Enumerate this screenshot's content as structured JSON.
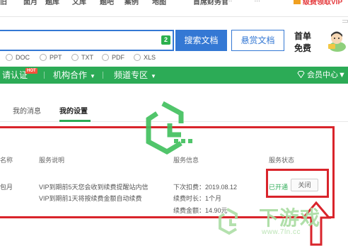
{
  "topbar": {
    "nav": [
      "旧",
      "面月",
      "题库",
      "文库",
      "题吧",
      "案例",
      "地图",
      "首席财务官"
    ],
    "user_id": "...********...",
    "vip_link": "级费领取VIP"
  },
  "search": {
    "count_badge": "2",
    "search_button": "搜索文档",
    "reward_button": "悬赏文档"
  },
  "promo": {
    "line1": "首单",
    "line2": "免费"
  },
  "file_types": [
    "DOC",
    "PPT",
    "TXT",
    "PDF",
    "XLS"
  ],
  "green_nav": {
    "items": [
      "请认证",
      "机构合作",
      "频道专区"
    ],
    "hot_tag": "HOT",
    "member_center": "会员中心"
  },
  "tabs": {
    "messages": "我的消息",
    "settings": "我的设置"
  },
  "service_table": {
    "headers": [
      "名称",
      "服务说明",
      "服务信息",
      "服务状态"
    ],
    "row": {
      "name": "包月",
      "desc_line1": "VIP到期前5天您会收到续费提醒站内信",
      "desc_line2": "VIP到期前1天将按续费金额自动续费",
      "info_line1": "下次扣费：2019.08.12",
      "info_line2": "续费时长：1个月",
      "info_line3": "续费金额：14.90元",
      "status": "已开通",
      "close_button": "关闭"
    }
  },
  "watermark": {
    "brand": "下游戏",
    "url": "www.7ln.cc"
  },
  "colors": {
    "green": "#2cab56",
    "blue": "#3478d4",
    "red": "#d9242b"
  }
}
